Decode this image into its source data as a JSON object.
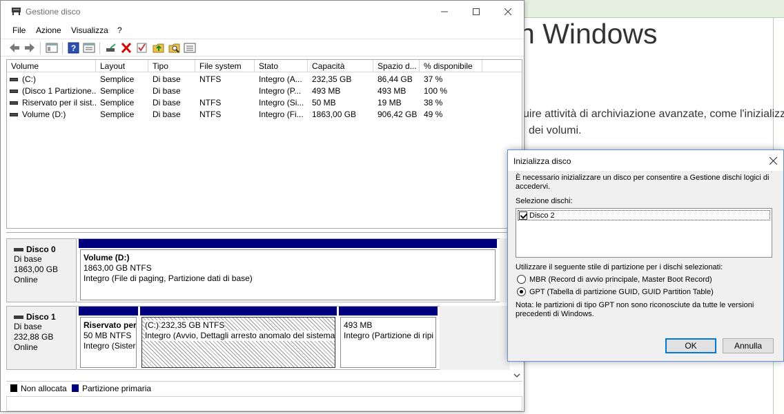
{
  "background": {
    "heading": "n Windows",
    "text_line1": "uire attività di archiviazione avanzate, come l'inizializz",
    "text_line2": "dei volumi."
  },
  "window": {
    "title": "Gestione disco",
    "menu": [
      "File",
      "Azione",
      "Visualizza",
      "?"
    ]
  },
  "volume_list": {
    "columns": [
      "Volume",
      "Layout",
      "Tipo",
      "File system",
      "Stato",
      "Capacità",
      "Spazio d...",
      "% disponibile"
    ],
    "rows": [
      {
        "volume": "(C:)",
        "layout": "Semplice",
        "tipo": "Di base",
        "fs": "NTFS",
        "stato": "Integro (A...",
        "capacita": "232,35 GB",
        "spazio": "86,44 GB",
        "perc": "37 %"
      },
      {
        "volume": "(Disco 1 Partizione...",
        "layout": "Semplice",
        "tipo": "Di base",
        "fs": "",
        "stato": "Integro (P...",
        "capacita": "493 MB",
        "spazio": "493 MB",
        "perc": "100 %"
      },
      {
        "volume": "Riservato per il sist...",
        "layout": "Semplice",
        "tipo": "Di base",
        "fs": "NTFS",
        "stato": "Integro (Si...",
        "capacita": "50 MB",
        "spazio": "19 MB",
        "perc": "38 %"
      },
      {
        "volume": "Volume (D:)",
        "layout": "Semplice",
        "tipo": "Di base",
        "fs": "NTFS",
        "stato": "Integro (Fi...",
        "capacita": "1863,00 GB",
        "spazio": "906,42 GB",
        "perc": "49 %"
      }
    ]
  },
  "disks": [
    {
      "name": "Disco 0",
      "type": "Di base",
      "size": "1863,00 GB",
      "status": "Online",
      "partitions": [
        {
          "title": "Volume  (D:)",
          "line1": "1863,00 GB NTFS",
          "line2": "Integro (File di paging, Partizione dati di base)"
        }
      ]
    },
    {
      "name": "Disco 1",
      "type": "Di base",
      "size": "232,88 GB",
      "status": "Online",
      "partitions": [
        {
          "title": "Riservato per",
          "line1": "50 MB NTFS",
          "line2": "Integro (Sister"
        },
        {
          "title": "(C:)",
          "line1": "232,35 GB NTFS",
          "line2": "Integro (Avvio, Dettagli arresto anomalo del sistema"
        },
        {
          "title": "",
          "line1": "493 MB",
          "line2": "Integro (Partizione di ripi"
        }
      ]
    }
  ],
  "legend": {
    "unallocated": "Non allocata",
    "primary": "Partizione primaria",
    "colors": {
      "unallocated": "#000000",
      "primary": "#00007f"
    }
  },
  "dialog": {
    "title": "Inizializza disco",
    "intro": "È necessario inizializzare un disco per consentire a Gestione dischi logici di accedervi.",
    "select_label": "Selezione dischi:",
    "disk_item": "Disco 2",
    "style_label": "Utilizzare il seguente stile di partizione per i dischi selezionati:",
    "option_mbr": "MBR (Record di avvio principale, Master Boot Record)",
    "option_gpt": "GPT (Tabella di partizione GUID, GUID Partition Table)",
    "note": "Nota: le partizioni di tipo GPT non sono riconosciute da tutte le versioni precedenti di Windows.",
    "ok": "OK",
    "cancel": "Annulla"
  }
}
